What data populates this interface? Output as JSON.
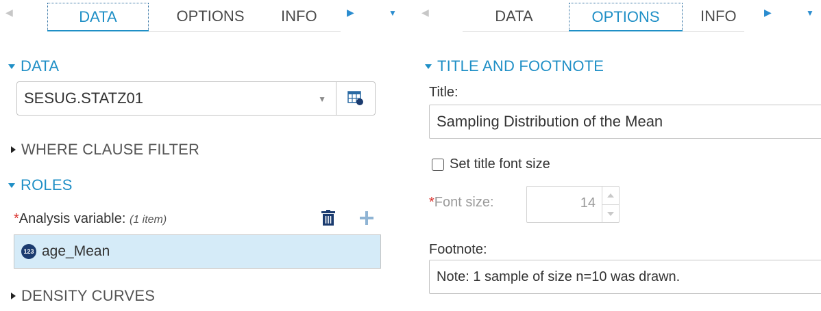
{
  "left_panel": {
    "tabs": [
      {
        "label": "DATA",
        "active": true
      },
      {
        "label": "OPTIONS",
        "active": false
      },
      {
        "label": "INFO",
        "active": false
      }
    ],
    "data_section": {
      "title": "DATA",
      "dataset_value": "SESUG.STATZ01"
    },
    "where_section": {
      "title": "WHERE CLAUSE FILTER"
    },
    "roles_section": {
      "title": "ROLES",
      "required_marker": "*",
      "analysis_label": "Analysis variable:",
      "item_count": "(1 item)",
      "variables": [
        {
          "type_badge": "123",
          "name": "age_Mean"
        }
      ]
    },
    "density_section": {
      "title": "DENSITY CURVES"
    }
  },
  "right_panel": {
    "tabs": [
      {
        "label": "DATA",
        "active": false
      },
      {
        "label": "OPTIONS",
        "active": true
      },
      {
        "label": "INFO",
        "active": false
      }
    ],
    "title_footnote_section": {
      "title": "TITLE AND FOOTNOTE",
      "title_label": "Title:",
      "title_value": "Sampling Distribution of the Mean",
      "checkbox_label": "Set title font size",
      "checkbox_checked": false,
      "required_marker": "*",
      "font_size_label": "Font size:",
      "font_size_value": "14",
      "footnote_label": "Footnote:",
      "footnote_value": "Note: 1 sample of size n=10 was drawn."
    }
  },
  "colors": {
    "accent": "#1f8fc6",
    "selected_row": "#d5ebf8",
    "required": "#d9302b",
    "badge": "#1b3b6f"
  }
}
